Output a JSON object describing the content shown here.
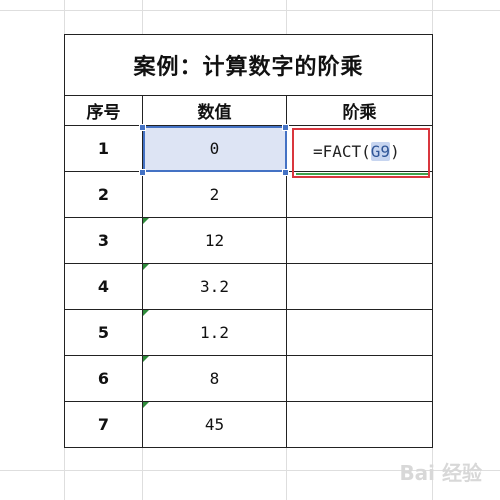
{
  "title": "案例：计算数字的阶乘",
  "headers": [
    "序号",
    "数值",
    "阶乘"
  ],
  "rows": [
    {
      "index": "1",
      "value": "0"
    },
    {
      "index": "2",
      "value": "2"
    },
    {
      "index": "3",
      "value": "12"
    },
    {
      "index": "4",
      "value": "3.2"
    },
    {
      "index": "5",
      "value": "1.2"
    },
    {
      "index": "6",
      "value": "8"
    },
    {
      "index": "7",
      "value": "45"
    }
  ],
  "formula": {
    "prefix": "=FACT(",
    "ref": "G9",
    "suffix": ")"
  },
  "watermark": "Bai 经验"
}
